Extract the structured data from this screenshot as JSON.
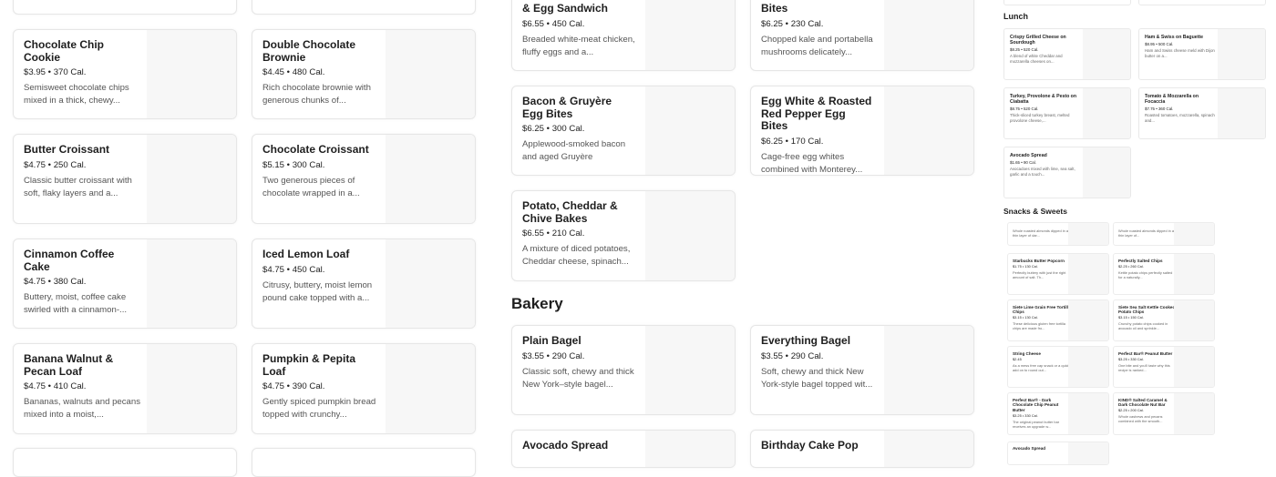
{
  "left_col1": [
    {
      "name": "Chocolate Chip Cookie",
      "price": "$3.95",
      "cal": "370 Cal.",
      "desc": "Semisweet chocolate chips mixed in a thick, chewy..."
    },
    {
      "name": "Butter Croissant",
      "price": "$4.75",
      "cal": "250 Cal.",
      "desc": "Classic butter croissant with soft, flaky layers and a..."
    },
    {
      "name": "Cinnamon Coffee Cake",
      "price": "$4.75",
      "cal": "380 Cal.",
      "desc": "Buttery, moist, coffee cake swirled with a cinnamon-..."
    },
    {
      "name": "Banana Walnut & Pecan Loaf",
      "price": "$4.75",
      "cal": "410 Cal.",
      "desc": "Bananas, walnuts and pecans mixed into a moist,..."
    }
  ],
  "left_col2": [
    {
      "name": "Double Chocolate Brownie",
      "price": "$4.45",
      "cal": "480 Cal.",
      "desc": "Rich chocolate brownie with generous chunks of..."
    },
    {
      "name": "Chocolate Croissant",
      "price": "$5.15",
      "cal": "300 Cal.",
      "desc": "Two generous pieces of chocolate wrapped in a..."
    },
    {
      "name": "Iced Lemon Loaf",
      "price": "$4.75",
      "cal": "450 Cal.",
      "desc": "Citrusy, buttery, moist lemon pound cake topped with a..."
    },
    {
      "name": "Pumpkin & Pepita Loaf",
      "price": "$4.75",
      "cal": "390 Cal.",
      "desc": "Gently spiced pumpkin bread topped with crunchy..."
    }
  ],
  "mid_col1": [
    {
      "name": "& Egg Sandwich",
      "price": "$6.55",
      "cal": "450 Cal.",
      "desc": "Breaded white-meat chicken, fluffy eggs and a..."
    },
    {
      "name": "Bacon & Gruyère Egg Bites",
      "price": "$6.25",
      "cal": "300 Cal.",
      "desc": "Applewood-smoked bacon and aged Gruyère Monterey..."
    },
    {
      "name": "Potato, Cheddar & Chive Bakes",
      "price": "$6.55",
      "cal": "210 Cal.",
      "desc": "A mixture of diced potatoes, Cheddar cheese, spinach..."
    }
  ],
  "mid_col2": [
    {
      "name": "Bites",
      "price": "$6.25",
      "cal": "230 Cal.",
      "desc": "Chopped kale and portabella mushrooms delicately..."
    },
    {
      "name": "Egg White & Roasted Red Pepper Egg Bites",
      "price": "$6.25",
      "cal": "170 Cal.",
      "desc": "Cage-free egg whites combined with Monterey..."
    }
  ],
  "bakery": {
    "title": "Bakery",
    "items": [
      {
        "name": "Plain Bagel",
        "price": "$3.55",
        "cal": "290 Cal.",
        "desc": "Classic soft, chewy and thick New York–style bagel..."
      },
      {
        "name": "Everything Bagel",
        "price": "$3.55",
        "cal": "290 Cal.",
        "desc": "Soft, chewy and thick New York-style bagel topped wit..."
      },
      {
        "name": "Avocado Spread",
        "price": "",
        "cal": "",
        "desc": ""
      },
      {
        "name": "Birthday Cake Pop",
        "price": "",
        "cal": "",
        "desc": ""
      }
    ]
  },
  "right": {
    "lunch_title": "Lunch",
    "lunch": [
      {
        "name": "Crispy Grilled Cheese on Sourdough",
        "price": "$8.25",
        "cal": "520 Cal.",
        "desc": "A blend of white Cheddar and mozzarella cheeses on..."
      },
      {
        "name": "Ham & Swiss on Baguette",
        "price": "$8.95",
        "cal": "500 Cal.",
        "desc": "Ham and Swiss cheese meld with Dijon butter on a..."
      },
      {
        "name": "Turkey, Provolone & Pesto on Ciabatta",
        "price": "$8.75",
        "cal": "520 Cal.",
        "desc": "Thick-sliced turkey breast, melted provolone cheese,..."
      },
      {
        "name": "Tomato & Mozzarella on Focaccia",
        "price": "$7.75",
        "cal": "360 Cal.",
        "desc": "Roasted tomatoes, mozzarella, spinach and..."
      },
      {
        "name": "Avocado Spread",
        "price": "$1.65",
        "cal": "90 Cal.",
        "desc": "Avocadoes mixed with lime, sea salt, garlic and a touch..."
      }
    ],
    "snacks_title": "Snacks & Sweets",
    "snacks": [
      {
        "name": "",
        "price": "",
        "cal": "",
        "desc": "Whole roasted almonds dipped in a thin layer of dar..."
      },
      {
        "name": "",
        "price": "",
        "cal": "",
        "desc": "Whole roasted almonds dipped in a thin layer of..."
      },
      {
        "name": "Starbucks Butter Popcorn",
        "price": "$1.75",
        "cal": "130 Cal.",
        "desc": "Perfectly buttery with just the right amount of salt. Th..."
      },
      {
        "name": "Perfectly Salted Chips",
        "price": "$2.25",
        "cal": "260 Cal.",
        "desc": "Kettle potato chips perfectly salted for a naturally..."
      },
      {
        "name": "Siete Lime Grain Free Tortilla Chips",
        "price": "$3.15",
        "cal": "130 Cal.",
        "desc": "These delicious gluten free tortilla chips are made fro..."
      },
      {
        "name": "Siete Sea Salt Kettle Cooked Potato Chips",
        "price": "$3.15",
        "cal": "150 Cal.",
        "desc": "Crunchy potato chips cooked in avocado oil and sprinkle..."
      },
      {
        "name": "String Cheese",
        "price": "$2.45",
        "cal": "",
        "desc": "As a mess free cap snack or a quick add on to round out..."
      },
      {
        "name": "Perfect Bar® Peanut Butter",
        "price": "$3.25",
        "cal": "330 Cal.",
        "desc": "One bite and you'll taste why this recipe is ranked..."
      },
      {
        "name": "Perfect Bar® - Dark Chocolate Chip Peanut Butter",
        "price": "$3.25",
        "cal": "330 Cal.",
        "desc": "The original peanut butter bar receives an upgrade w..."
      },
      {
        "name": "KIND® Salted Caramel & Dark Chocolate Nut Bar",
        "price": "$2.25",
        "cal": "200 Cal.",
        "desc": "Whole cashews and pecans combined with the smooth..."
      },
      {
        "name": "Avocado Spread",
        "price": "",
        "cal": "",
        "desc": ""
      }
    ]
  }
}
